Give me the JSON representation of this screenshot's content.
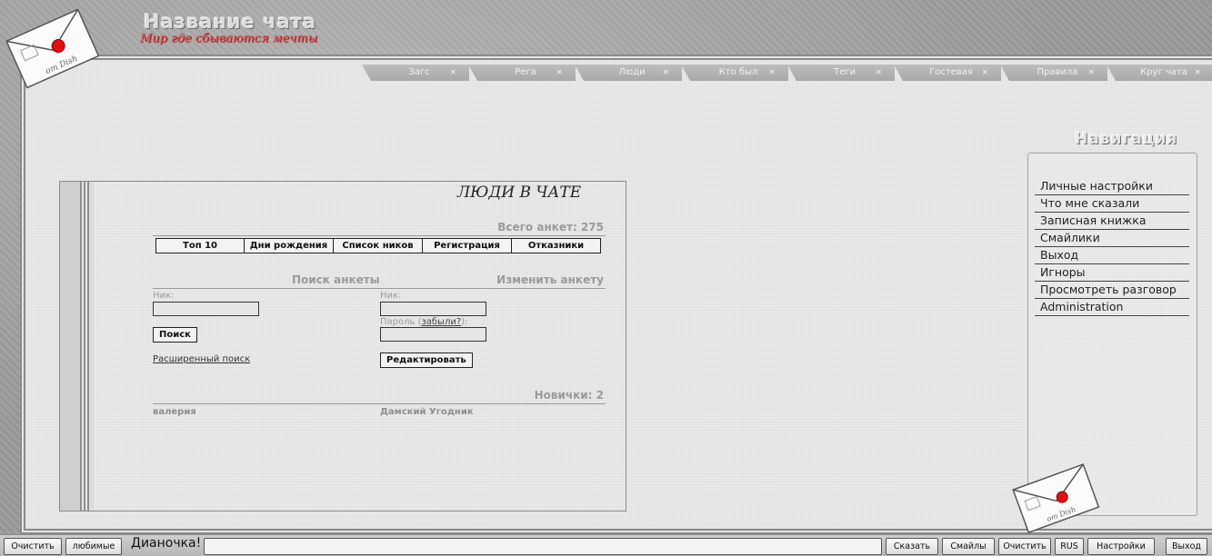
{
  "header": {
    "chat_title": "Название чата",
    "chat_subtitle": "Мир где сбываются мечты",
    "logo_text": "от Dish"
  },
  "tabs": [
    {
      "label": "Загс",
      "close": "×"
    },
    {
      "label": "Рега",
      "close": "×"
    },
    {
      "label": "Люди",
      "close": "×"
    },
    {
      "label": "Кто был",
      "close": "×"
    },
    {
      "label": "Теги",
      "close": "×"
    },
    {
      "label": "Гостевая",
      "close": "×"
    },
    {
      "label": "Правила",
      "close": "×"
    },
    {
      "label": "Круг чата",
      "close": "×"
    }
  ],
  "people": {
    "title": "ЛЮДИ В ЧАТЕ",
    "total": "Всего анкет: 275",
    "buttons": [
      "Топ 10",
      "Дни рождения",
      "Список ников",
      "Регистрация",
      "Отказники"
    ],
    "search": {
      "heading": "Поиск анкеты",
      "nick_label": "Ник:",
      "nick_value": "",
      "button": "Поиск",
      "advanced_link": "Расширенный поиск"
    },
    "edit": {
      "heading": "Изменить анкету",
      "nick_label": "Ник:",
      "nick_value": "",
      "password_label": "Пароль (",
      "forgot_link": "забыли?",
      "password_label_end": "):",
      "password_value": "",
      "button": "Редактировать"
    },
    "newbies": {
      "heading": "Новички: 2",
      "names": [
        "валерия",
        "Дамский Угодник"
      ]
    }
  },
  "navigation": {
    "title": "Навигация",
    "items": [
      "Личные настройки",
      "Что мне сказали",
      "Записная книжка",
      "Смайлики",
      "Выход",
      "Игноры",
      "Просмотреть разговор",
      "Administration"
    ]
  },
  "bottom_bar": {
    "clear_left": "Очистить",
    "favorites": "любимые",
    "nickname": "Дианочка!",
    "message_value": "",
    "say": "Сказать",
    "smileys": "Смайлы",
    "clear_right": "Очистить",
    "language": "RUS",
    "settings": "Настройки",
    "exit": "Выход"
  },
  "colors": {
    "accent_red": "#e84848",
    "seal_red": "#e01010",
    "frame_bg": "#e9e9e9",
    "muted_text": "#9a9a9a"
  }
}
